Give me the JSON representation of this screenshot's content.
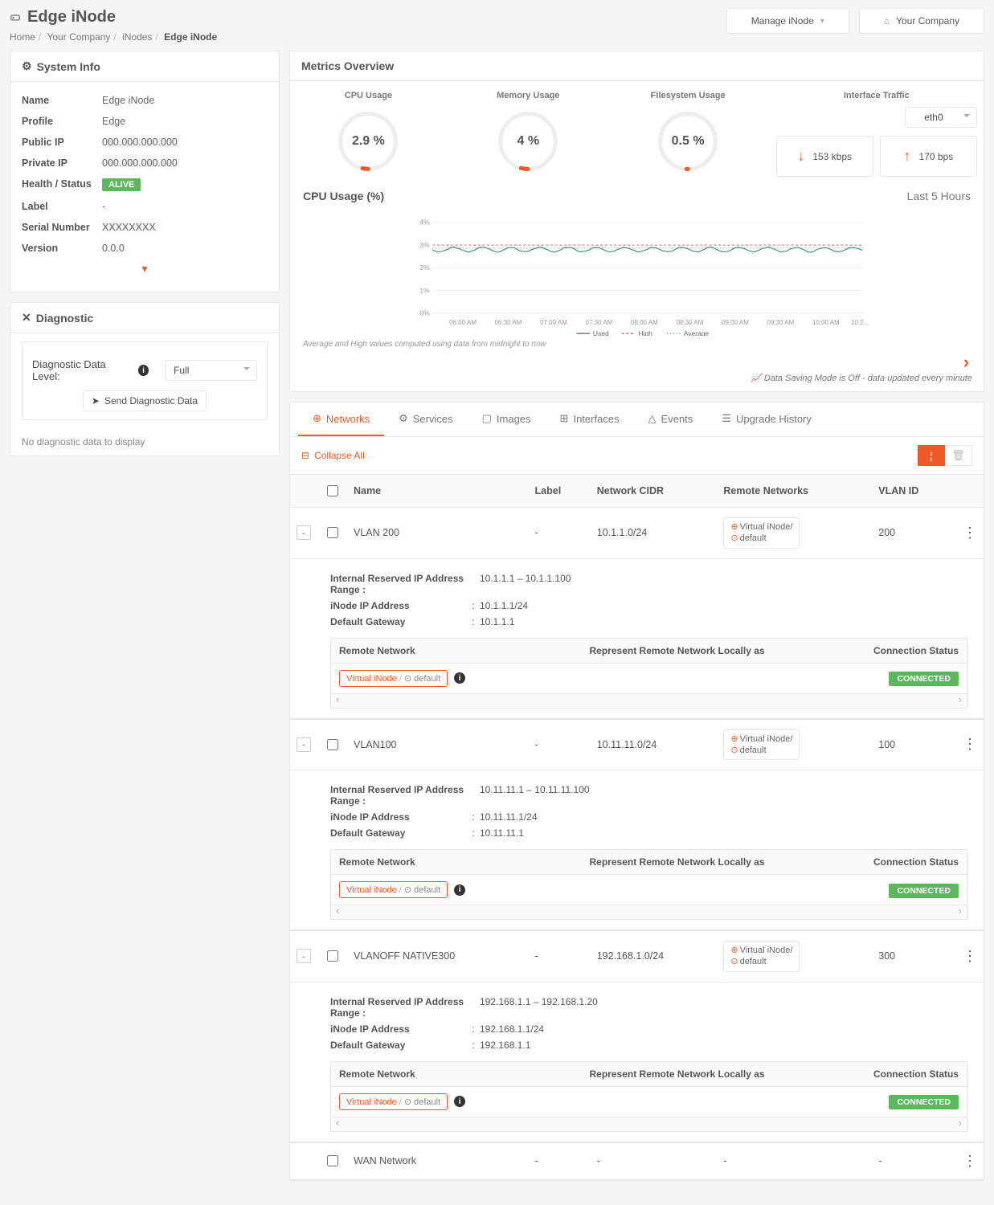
{
  "header": {
    "icon": "disk-icon",
    "title": "Edge iNode",
    "manage_label": "Manage iNode",
    "company_label": "Your Company"
  },
  "breadcrumb": {
    "items": [
      "Home",
      "Your Company",
      "iNodes"
    ],
    "current": "Edge iNode"
  },
  "system_info": {
    "panel_title": "System Info",
    "rows": {
      "name_k": "Name",
      "name_v": "Edge iNode",
      "profile_k": "Profile",
      "profile_v": "Edge",
      "publicip_k": "Public IP",
      "publicip_v": "",
      "privateip_k": "Private IP",
      "privateip_v": "",
      "health_k": "Health / Status",
      "health_badge": "ALIVE",
      "label_k": "Label",
      "label_v": "-",
      "serial_k": "Serial Number",
      "serial_v": "",
      "version_k": "Version",
      "version_v": ""
    }
  },
  "diagnostic": {
    "panel_title": "Diagnostic",
    "level_label": "Diagnostic Data Level:",
    "level_value": "Full",
    "send_btn": "Send Diagnostic Data",
    "empty": "No diagnostic data to display"
  },
  "metrics": {
    "panel_title": "Metrics Overview",
    "gauges": {
      "cpu_t": "CPU Usage",
      "cpu_v": "2.9 %",
      "mem_t": "Memory Usage",
      "mem_v": "4 %",
      "fs_t": "Filesystem Usage",
      "fs_v": "0.5 %",
      "iface_t": "Interface Traffic",
      "iface_select": "eth0",
      "down_v": "153 kbps",
      "up_v": "170 bps"
    },
    "chart_title": "CPU Usage (%)",
    "chart_range": "Last 5 Hours",
    "footnote": "Average and High values computed using data from midnight to now",
    "legend": {
      "used": "Used",
      "high": "High",
      "avg": "Average"
    },
    "data_saving": "Data Saving Mode is Off - data updated every minute"
  },
  "chart_data": {
    "type": "line",
    "title": "CPU Usage (%)",
    "xlabel": "",
    "ylabel": "",
    "ylim": [
      0,
      4
    ],
    "yticks": [
      0,
      1,
      2,
      3,
      4
    ],
    "ytick_labels": [
      "0%",
      "1%",
      "2%",
      "3%",
      "4%"
    ],
    "xticks": [
      "06:00 AM",
      "06:30 AM",
      "07:00 AM",
      "07:30 AM",
      "08:00 AM",
      "08:30 AM",
      "09:00 AM",
      "09:30 AM",
      "10:00 AM",
      "10:2..."
    ],
    "series": [
      {
        "name": "Used",
        "approx_constant": 2.8,
        "oscillation": 0.15
      },
      {
        "name": "High",
        "approx_constant": 3.0
      },
      {
        "name": "Average",
        "approx_constant": 2.85
      }
    ]
  },
  "tabs": {
    "items": [
      {
        "label": "Networks",
        "active": true
      },
      {
        "label": "Services"
      },
      {
        "label": "Images"
      },
      {
        "label": "Interfaces"
      },
      {
        "label": "Events"
      },
      {
        "label": "Upgrade History"
      }
    ],
    "collapse_all": "Collapse All"
  },
  "net_table": {
    "cols": {
      "name": "Name",
      "label": "Label",
      "cidr": "Network CIDR",
      "remote": "Remote Networks",
      "vlan": "VLAN ID"
    },
    "detail_labels": {
      "range": "Internal Reserved IP Address Range",
      "ip": "iNode IP Address",
      "gw": "Default Gateway",
      "remote": "Remote Network",
      "represent": "Represent Remote Network Locally as",
      "status": "Connection Status",
      "connected": "CONNECTED",
      "remote_pill_a": "Virtual iNode",
      "remote_pill_b": "default",
      "remote_tag": "Virtual iNode/",
      "remote_tag2": "default"
    },
    "rows": [
      {
        "name": "VLAN 200",
        "label": "-",
        "cidr": "10.1.1.0/24",
        "vlan": "200",
        "detail": {
          "range": "10.1.1.1 – 10.1.1.100",
          "ip": "10.1.1.1/24",
          "gw": "10.1.1.1"
        }
      },
      {
        "name": "VLAN100",
        "label": "-",
        "cidr": "10.11.11.0/24",
        "vlan": "100",
        "detail": {
          "range": "10.11.11.1 – 10.11.11.100",
          "ip": "10.11.11.1/24",
          "gw": "10.11.11.1"
        }
      },
      {
        "name": "VLANOFF NATIVE300",
        "label": "-",
        "cidr": "192.168.1.0/24",
        "vlan": "300",
        "detail": {
          "range": "192.168.1.1 – 192.168.1.20",
          "ip": "192.168.1.1/24",
          "gw": "192.168.1.1"
        }
      },
      {
        "name": "WAN Network",
        "label": "-",
        "cidr": "-",
        "remote": "-",
        "vlan": "-",
        "no_expand": true
      }
    ]
  }
}
